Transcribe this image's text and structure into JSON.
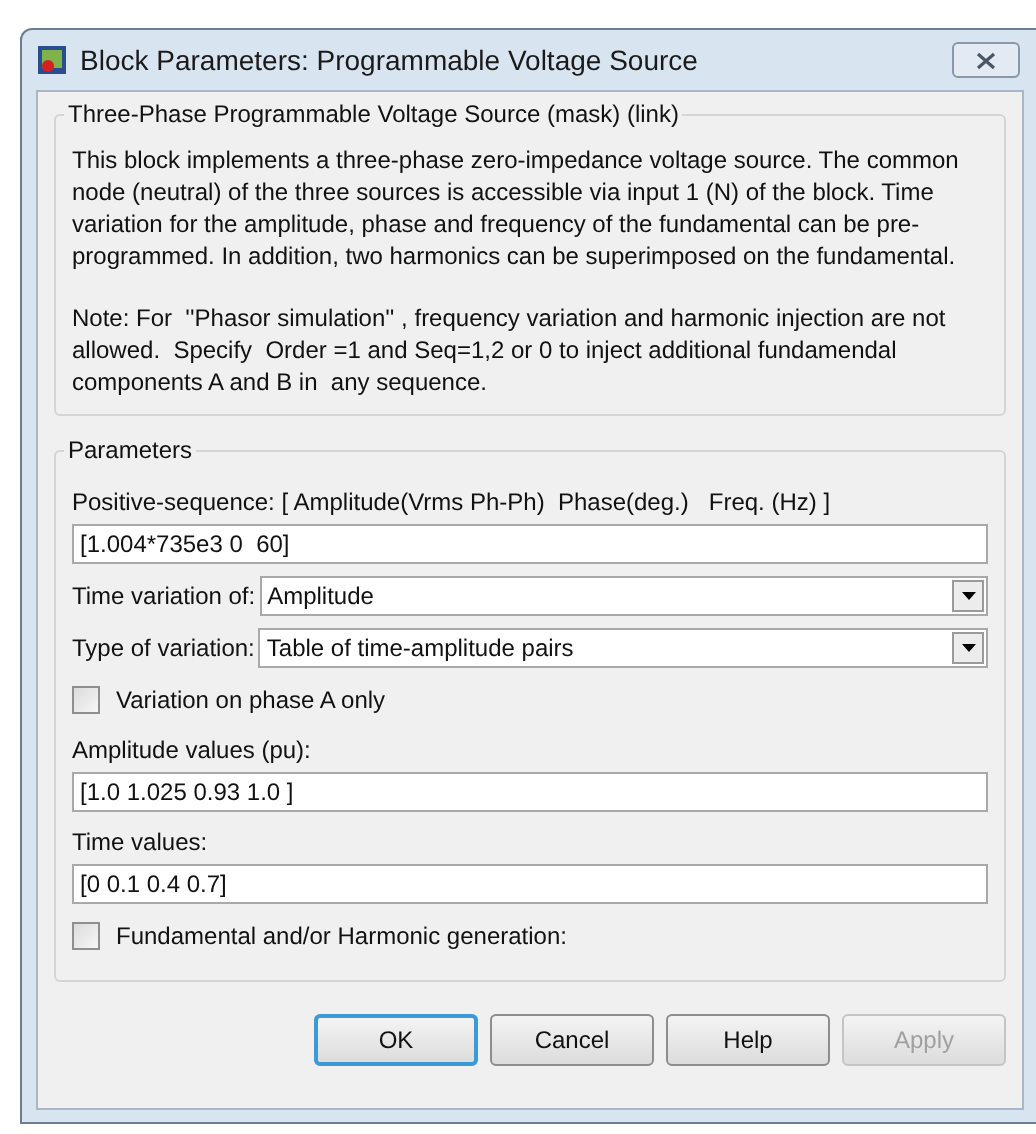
{
  "window": {
    "title": "Block Parameters: Programmable Voltage Source"
  },
  "description": {
    "title": "Three-Phase Programmable Voltage Source (mask) (link)",
    "paragraphs": [
      "This block implements a three-phase zero-impedance voltage source. The common node (neutral) of the three sources is accessible via input 1 (N) of the block. Time variation for the amplitude, phase and frequency of the fundamental can be pre-programmed. In addition, two harmonics can be superimposed on the fundamental.",
      "Note: For  ''Phasor simulation'' , frequency variation and harmonic injection are not allowed.  Specify  Order =1 and Seq=1,2 or 0 to inject additional fundamendal components A and B in  any sequence."
    ]
  },
  "parameters": {
    "title": "Parameters",
    "items": [
      {
        "kind": "text",
        "label": "Positive-sequence: [ Amplitude(Vrms Ph-Ph)  Phase(deg.)   Freq. (Hz) ]",
        "value": "[1.004*735e3 0  60]"
      },
      {
        "kind": "dropdown",
        "label": "Time variation of:",
        "value": "Amplitude"
      },
      {
        "kind": "dropdown",
        "label": "Type of variation:",
        "value": "Table of time-amplitude pairs"
      },
      {
        "kind": "checkbox",
        "label": "Variation on phase A only",
        "checked": false
      },
      {
        "kind": "text",
        "label": "Amplitude values (pu):",
        "value": "[1.0 1.025 0.93 1.0 ]"
      },
      {
        "kind": "text",
        "label": "Time values:",
        "value": "[0 0.1 0.4 0.7]"
      },
      {
        "kind": "checkbox",
        "label": "Fundamental and/or Harmonic generation:",
        "checked": false
      }
    ]
  },
  "buttons": [
    {
      "label": "OK",
      "focused": true,
      "disabled": false
    },
    {
      "label": "Cancel",
      "focused": false,
      "disabled": false
    },
    {
      "label": "Help",
      "focused": false,
      "disabled": false
    },
    {
      "label": "Apply",
      "focused": false,
      "disabled": true
    }
  ]
}
